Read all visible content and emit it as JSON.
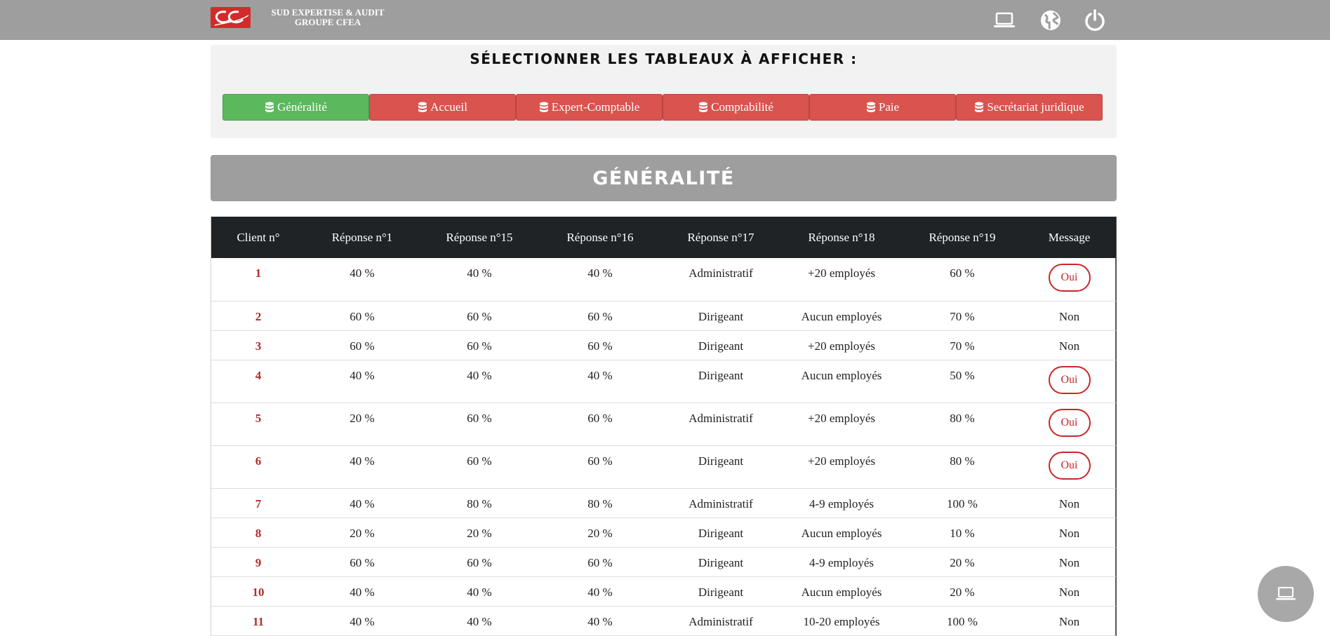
{
  "header": {
    "brand_line1": "SUD EXPERTISE & AUDIT",
    "brand_line2": "GROUPE CFEA",
    "icons": [
      "laptop-icon",
      "globe-icon",
      "power-icon"
    ]
  },
  "selection": {
    "title": "SÉLECTIONNER LES TABLEAUX À AFFICHER :",
    "buttons": [
      {
        "label": "Généralité",
        "state": "active",
        "color": "#5cb85c"
      },
      {
        "label": "Accueil",
        "state": "inactive",
        "color": "#d9534f"
      },
      {
        "label": "Expert-Comptable",
        "state": "inactive",
        "color": "#d9534f"
      },
      {
        "label": "Comptabilité",
        "state": "inactive",
        "color": "#d9534f"
      },
      {
        "label": "Paie",
        "state": "inactive",
        "color": "#d9534f"
      },
      {
        "label": "Secrétariat juridique",
        "state": "inactive",
        "color": "#d9534f"
      }
    ]
  },
  "section": {
    "title": "GÉNÉRALITÉ"
  },
  "table": {
    "columns": [
      "Client n°",
      "Réponse n°1",
      "Réponse n°15",
      "Réponse n°16",
      "Réponse n°17",
      "Réponse n°18",
      "Réponse n°19",
      "Message"
    ],
    "rows": [
      [
        "1",
        "40 %",
        "40 %",
        "40 %",
        "Administratif",
        "+20 employés",
        "60 %",
        "Oui"
      ],
      [
        "2",
        "60 %",
        "60 %",
        "60 %",
        "Dirigeant",
        "Aucun employés",
        "70 %",
        "Non"
      ],
      [
        "3",
        "60 %",
        "60 %",
        "60 %",
        "Dirigeant",
        "+20 employés",
        "70 %",
        "Non"
      ],
      [
        "4",
        "40 %",
        "40 %",
        "40 %",
        "Dirigeant",
        "Aucun employés",
        "50 %",
        "Oui"
      ],
      [
        "5",
        "20 %",
        "60 %",
        "60 %",
        "Administratif",
        "+20 employés",
        "80 %",
        "Oui"
      ],
      [
        "6",
        "40 %",
        "60 %",
        "60 %",
        "Dirigeant",
        "+20 employés",
        "80 %",
        "Oui"
      ],
      [
        "7",
        "40 %",
        "80 %",
        "80 %",
        "Administratif",
        "4-9 employés",
        "100 %",
        "Non"
      ],
      [
        "8",
        "20 %",
        "20 %",
        "20 %",
        "Dirigeant",
        "Aucun employés",
        "10 %",
        "Non"
      ],
      [
        "9",
        "60 %",
        "60 %",
        "60 %",
        "Dirigeant",
        "4-9 employés",
        "20 %",
        "Non"
      ],
      [
        "10",
        "40 %",
        "40 %",
        "40 %",
        "Dirigeant",
        "Aucun employés",
        "20 %",
        "Non"
      ],
      [
        "11",
        "40 %",
        "40 %",
        "40 %",
        "Administratif",
        "10-20 employés",
        "100 %",
        "Non"
      ]
    ]
  },
  "colors": {
    "topbar": "#9e9e9e",
    "active_button": "#5cb85c",
    "inactive_button": "#d9534f",
    "table_header": "#1f2326",
    "client_number": "#b52a2a",
    "oui_badge": "#c62828"
  },
  "fab": {
    "icon": "laptop-icon"
  }
}
